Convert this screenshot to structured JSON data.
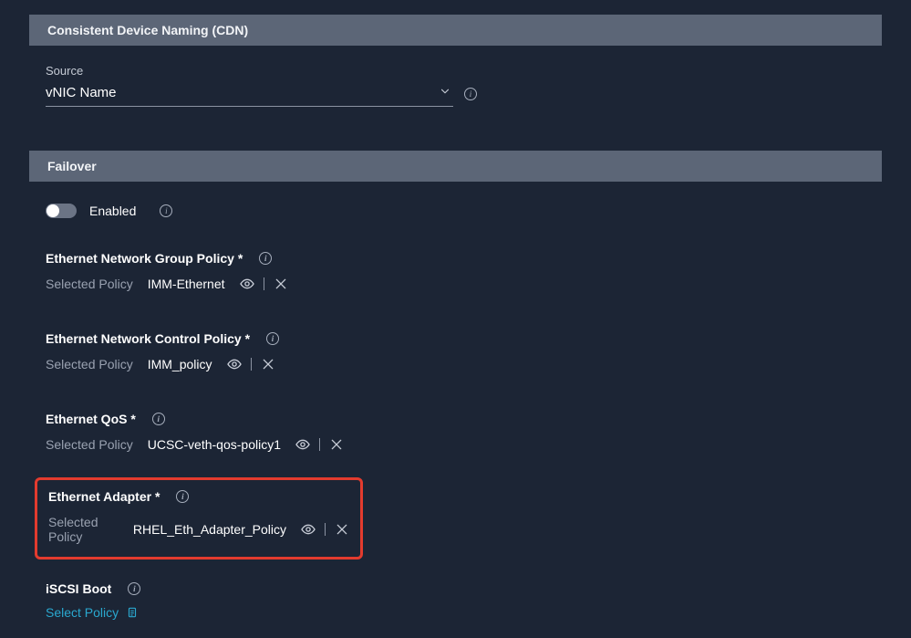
{
  "cdn": {
    "header": "Consistent Device Naming (CDN)",
    "source_label": "Source",
    "source_value": "vNIC Name"
  },
  "failover": {
    "header": "Failover",
    "enabled_label": "Enabled",
    "enabled": false
  },
  "selected_policy_label": "Selected Policy",
  "group": {
    "title": "Ethernet Network Group Policy *",
    "policy": "IMM-Ethernet"
  },
  "control": {
    "title": "Ethernet Network Control Policy *",
    "policy": "IMM_policy"
  },
  "qos": {
    "title": "Ethernet QoS *",
    "policy": "UCSC-veth-qos-policy1"
  },
  "adapter": {
    "title": "Ethernet Adapter *",
    "policy": "RHEL_Eth_Adapter_Policy"
  },
  "iscsi": {
    "title": "iSCSI Boot",
    "select_policy_label": "Select Policy"
  }
}
